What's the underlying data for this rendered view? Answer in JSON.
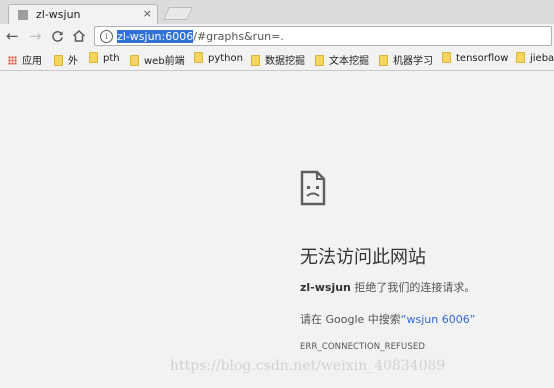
{
  "tab": {
    "title": "zl-wsjun",
    "close": "×"
  },
  "toolbar": {
    "back": "←",
    "forward": "→",
    "reload": "C",
    "home": "⌂",
    "info": "i",
    "url_host": "zl-wsjun:6006",
    "url_rest": "/#graphs&run=."
  },
  "bookmarks": {
    "apps_label": "应用",
    "items": [
      "外",
      "pth",
      "web前端",
      "python",
      "数据挖掘",
      "文本挖掘",
      "机器学习",
      "tensorflow",
      "jieba"
    ]
  },
  "error": {
    "title": "无法访问此网站",
    "host": "zl-wsjun",
    "desc_suffix": " 拒绝了我们的连接请求。",
    "suggest_prefix": "请在 Google 中搜索",
    "suggest_link": "“wsjun 6006”",
    "code": "ERR_CONNECTION_REFUSED"
  },
  "watermark": "https://blog.csdn.net/weixin_40834089",
  "icons": {
    "favicon": "page-favicon",
    "sad_face": "sad-document-icon",
    "folder": "folder-icon",
    "apps": "apps-grid-icon"
  },
  "colors": {
    "link": "#3367d6",
    "url_highlight": "#3271d8",
    "folder": "#f4d65e"
  }
}
